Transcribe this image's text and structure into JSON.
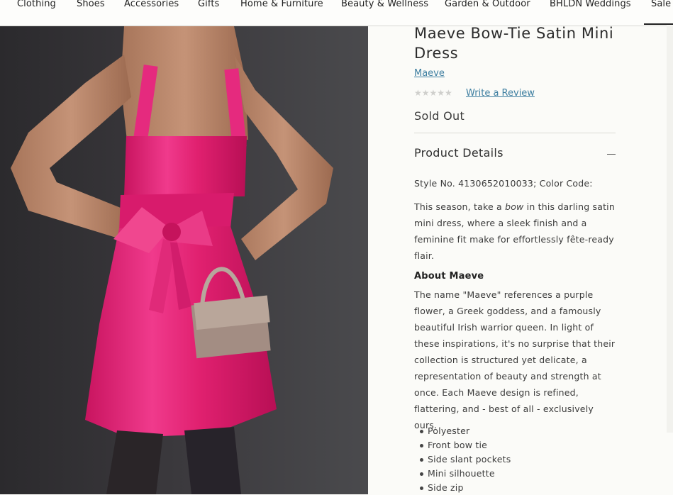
{
  "nav": {
    "items": [
      "Clothing",
      "Shoes",
      "Accessories",
      "Gifts",
      "Home & Furniture",
      "Beauty & Wellness",
      "Garden & Outdoor",
      "BHLDN Weddings",
      "Sale"
    ]
  },
  "product": {
    "title": "Maeve Bow-Tie Satin Mini Dress",
    "brand": "Maeve",
    "rating_stars": "★★★★★",
    "review_link": "Write a Review",
    "availability": "Sold Out",
    "image_alt_colors": {
      "dress": "#e8217a",
      "background": "#353437"
    }
  },
  "details": {
    "heading": "Product Details",
    "style_line": "Style No. 4130652010033; Color Code:",
    "description_pre": "This season, take a ",
    "description_em": "bow",
    "description_post": " in this darling satin mini dress, where a sleek finish and a feminine fit make for effortlessly fête-ready flair.",
    "about_heading": "About Maeve",
    "about_text": "The name \"Maeve\" references a purple flower, a Greek goddess, and a famously beautiful Irish warrior queen. In light of these inspirations, it's no surprise that their collection is structured yet delicate, a representation of beauty and strength at once. Each Maeve design is refined, flattering, and - best of all - exclusively ours.",
    "features": [
      "Polyester",
      "Front bow tie",
      "Side slant pockets",
      "Mini silhouette",
      "Side zip"
    ]
  }
}
